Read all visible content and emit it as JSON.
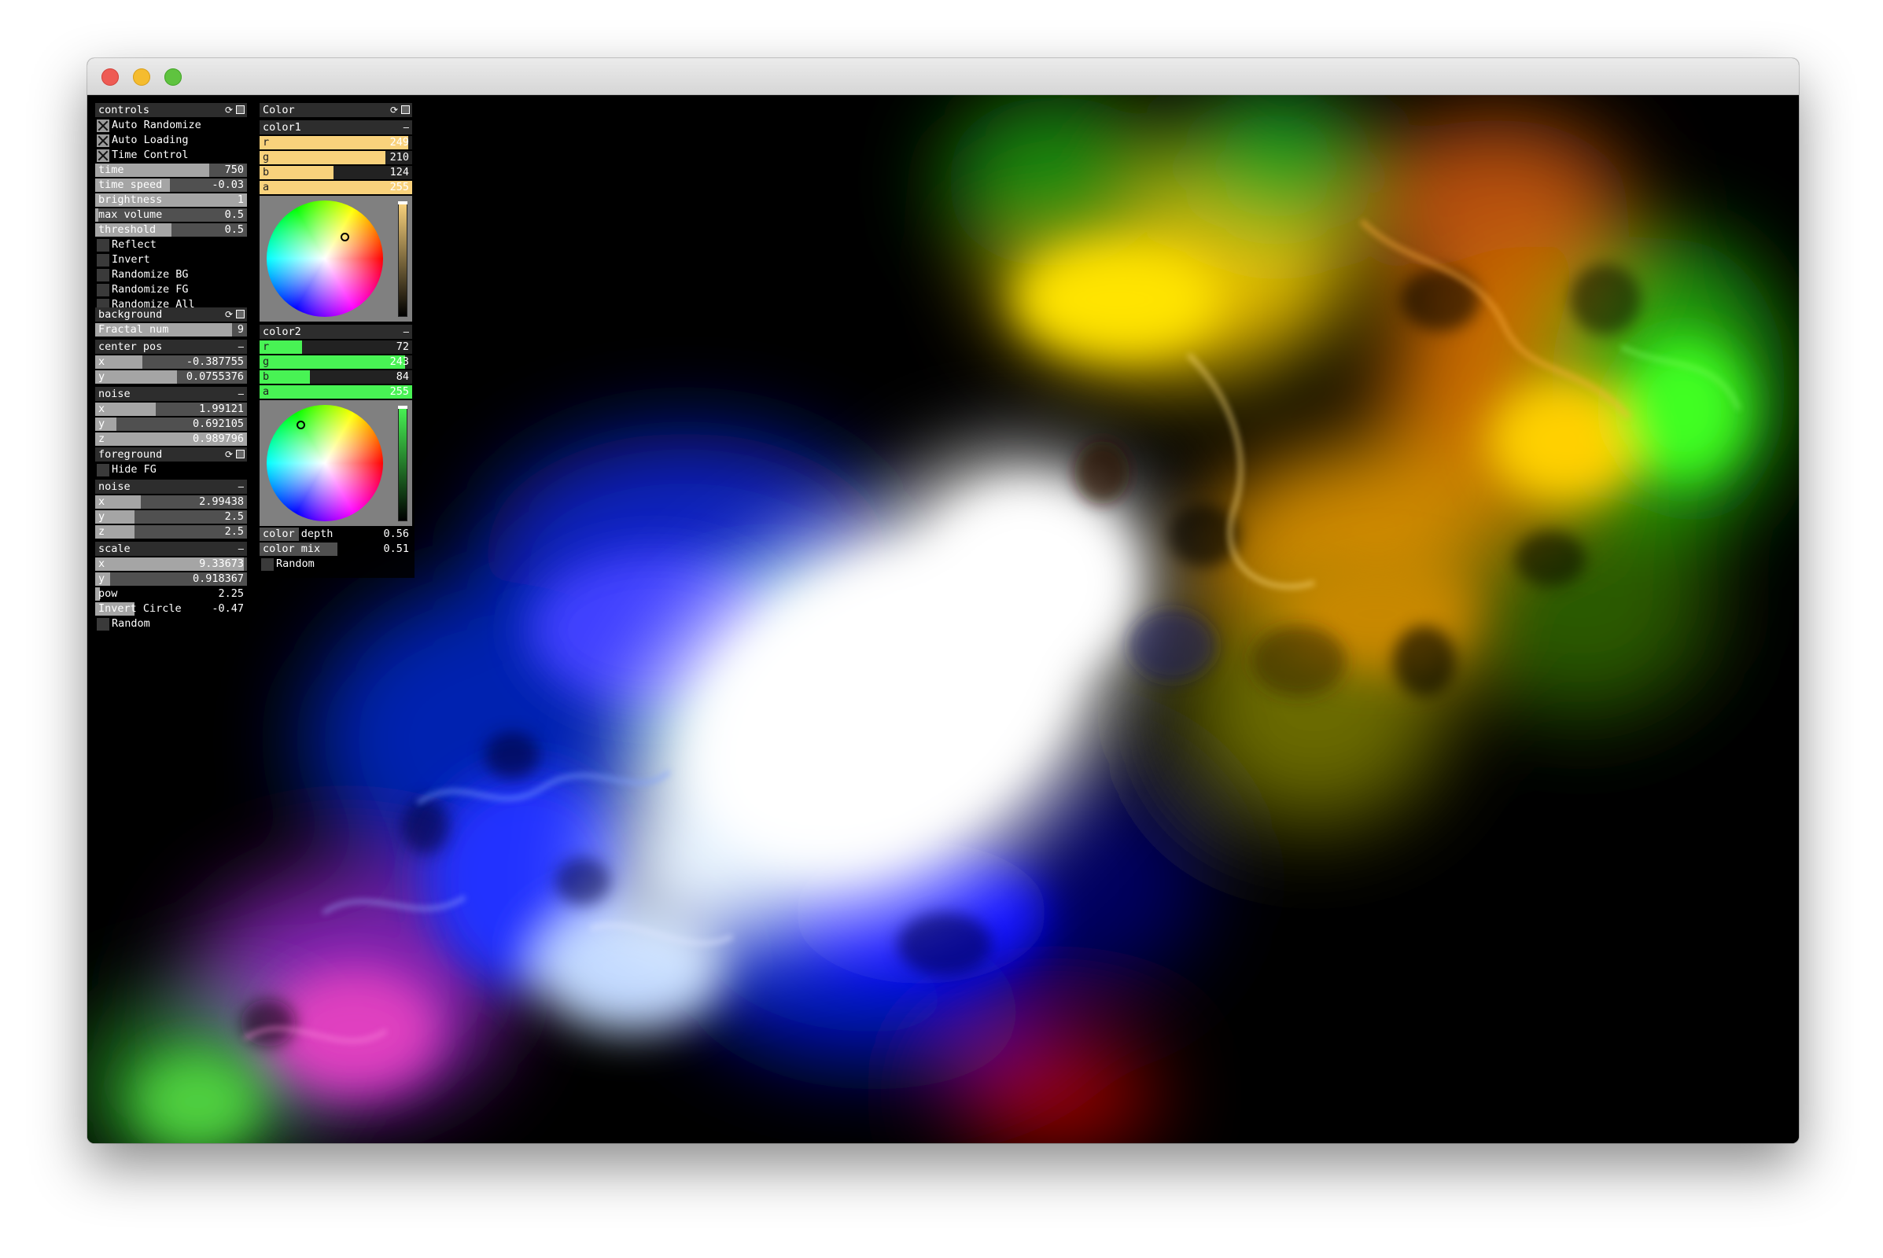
{
  "window": {
    "traffic_lights": [
      "close",
      "minimize",
      "maximize"
    ]
  },
  "controls": {
    "title": "controls",
    "toggles": [
      {
        "label": "Auto Randomize",
        "checked": true
      },
      {
        "label": "Auto Loading",
        "checked": true
      },
      {
        "label": "Time Control",
        "checked": true
      }
    ],
    "sliders": [
      {
        "label": "time",
        "value": "750",
        "fill": 0.75
      },
      {
        "label": "time speed",
        "value": "-0.03",
        "fill": 0.49
      },
      {
        "label": "brightness",
        "value": "1",
        "fill": 1.0
      },
      {
        "label": "max volume",
        "value": "0.5",
        "fill": 0.02
      },
      {
        "label": "threshold",
        "value": "0.5",
        "fill": 0.5
      }
    ],
    "toggles2": [
      {
        "label": "Reflect",
        "checked": false
      },
      {
        "label": "Invert",
        "checked": false
      },
      {
        "label": "Randomize BG",
        "checked": false
      },
      {
        "label": "Randomize FG",
        "checked": false
      },
      {
        "label": "Randomize All",
        "checked": false
      }
    ],
    "background": {
      "title": "background",
      "fractal": {
        "label": "Fractal num",
        "value": "9",
        "fill": 0.9
      },
      "center_pos": {
        "title": "center pos",
        "x": {
          "label": "x",
          "value": "-0.387755",
          "fill": 0.31
        },
        "y": {
          "label": "y",
          "value": "0.0755376",
          "fill": 0.54
        }
      },
      "noise": {
        "title": "noise",
        "x": {
          "label": "x",
          "value": "1.99121",
          "fill": 0.4
        },
        "y": {
          "label": "y",
          "value": "0.692105",
          "fill": 0.14
        },
        "z": {
          "label": "z",
          "value": "0.989796",
          "fill": 1.0
        }
      }
    },
    "foreground": {
      "title": "foreground",
      "hide_fg": {
        "label": "Hide FG",
        "checked": false
      },
      "noise": {
        "title": "noise",
        "x": {
          "label": "x",
          "value": "2.99438",
          "fill": 0.3
        },
        "y": {
          "label": "y",
          "value": "2.5",
          "fill": 0.26
        },
        "z": {
          "label": "z",
          "value": "2.5",
          "fill": 0.26
        }
      },
      "scale": {
        "title": "scale",
        "x": {
          "label": "x",
          "value": "9.33673",
          "fill": 0.98
        },
        "y": {
          "label": "y",
          "value": "0.918367",
          "fill": 0.1
        }
      },
      "pow": {
        "label": "pow",
        "value": "2.25",
        "fill": 0.03
      },
      "invert_circle": {
        "label": "Invert Circle",
        "value": "-0.47",
        "fill": 0.26
      },
      "random": {
        "label": "Random",
        "checked": false
      }
    }
  },
  "color": {
    "title": "Color",
    "color1": {
      "title": "color1",
      "rgba_hex": "#f9d27c",
      "channels": [
        {
          "label": "r",
          "value": "249",
          "fill": 0.976
        },
        {
          "label": "g",
          "value": "210",
          "fill": 0.824
        },
        {
          "label": "b",
          "value": "124",
          "fill": 0.486
        },
        {
          "label": "a",
          "value": "255",
          "fill": 1.0
        }
      ]
    },
    "color2": {
      "title": "color2",
      "rgba_hex": "#48f354",
      "channels": [
        {
          "label": "r",
          "value": "72",
          "fill": 0.28
        },
        {
          "label": "g",
          "value": "243",
          "fill": 0.953
        },
        {
          "label": "b",
          "value": "84",
          "fill": 0.33
        },
        {
          "label": "a",
          "value": "255",
          "fill": 1.0
        }
      ]
    },
    "color_depth": {
      "label": "color depth",
      "value": "0.56",
      "fill": 0.26
    },
    "color_mix": {
      "label": "color mix",
      "value": "0.51",
      "fill": 0.51
    },
    "random": {
      "label": "Random",
      "checked": false
    }
  },
  "colors": {
    "slider_fill": "#a5a5a5",
    "slider_bg": "#505050",
    "header_bg": "#2d2d2d"
  }
}
